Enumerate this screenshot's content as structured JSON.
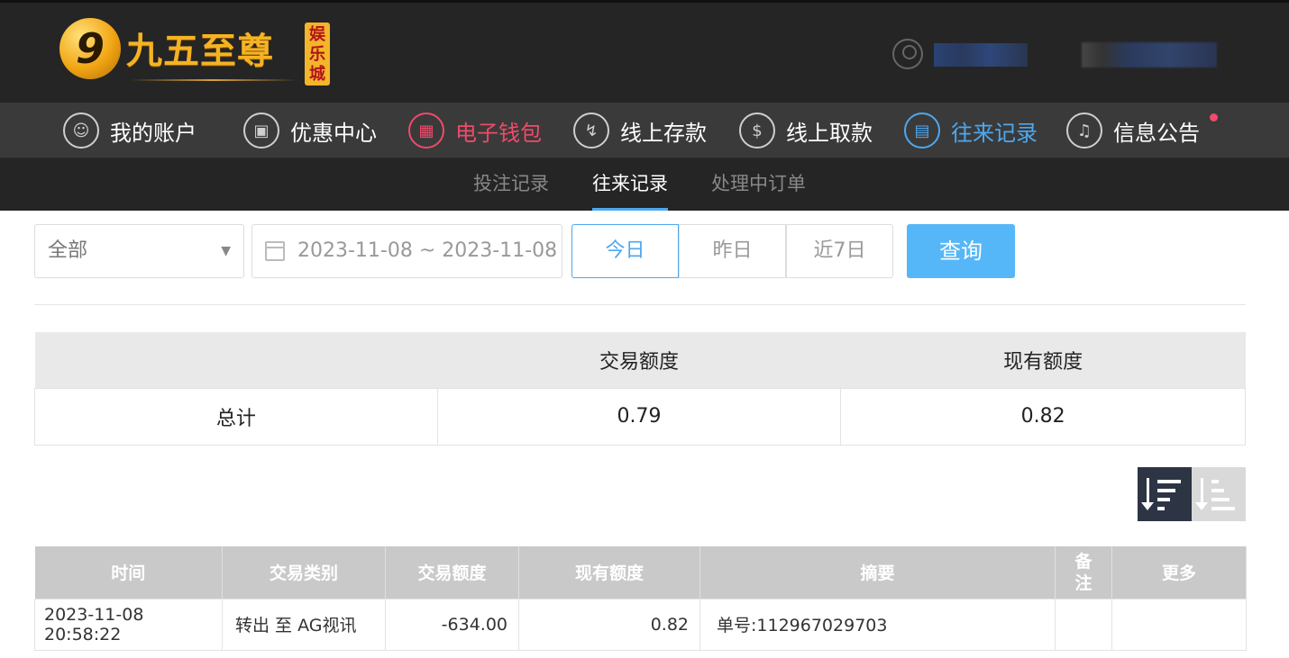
{
  "brand": {
    "logo_mark": "9",
    "name": "九五至尊",
    "sub": "娱乐城"
  },
  "nav": [
    {
      "label": "我的账户",
      "icon": "user-icon",
      "state": "normal"
    },
    {
      "label": "优惠中心",
      "icon": "gift-icon",
      "state": "normal"
    },
    {
      "label": "电子钱包",
      "icon": "wallet-icon",
      "state": "highlight-red"
    },
    {
      "label": "线上存款",
      "icon": "deposit-icon",
      "state": "normal"
    },
    {
      "label": "线上取款",
      "icon": "withdraw-icon",
      "state": "normal"
    },
    {
      "label": "往来记录",
      "icon": "records-icon",
      "state": "active-blue"
    },
    {
      "label": "信息公告",
      "icon": "bell-icon",
      "state": "normal"
    }
  ],
  "subnav": {
    "tabs": [
      "投注记录",
      "往来记录",
      "处理中订单"
    ],
    "active": "往来记录"
  },
  "filter": {
    "type_value": "全部",
    "date_range": "2023-11-08 ~ 2023-11-08",
    "quick": [
      "今日",
      "昨日",
      "近7日"
    ],
    "quick_active": "今日",
    "query_label": "查询"
  },
  "summary": {
    "headers": [
      "",
      "交易额度",
      "现有额度"
    ],
    "row_label": "总计",
    "trade_amount": "0.79",
    "current_amount": "0.82"
  },
  "records": {
    "headers": [
      "时间",
      "交易类别",
      "交易额度",
      "现有额度",
      "摘要",
      "备注",
      "更多"
    ],
    "rows": [
      {
        "time": "2023-11-08 20:58:22",
        "type": "转出 至 AG视讯",
        "amount": "-634.00",
        "balance": "0.82",
        "summary": "单号:112967029703",
        "note": "",
        "more": ""
      }
    ]
  },
  "colors": {
    "accent_blue": "#4da8f0",
    "accent_red": "#ee4b6b",
    "header_bg": "#252525",
    "nav_bg": "#3a3a3a",
    "query_btn": "#55b7f7"
  }
}
